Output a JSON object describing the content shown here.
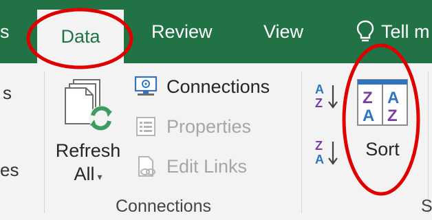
{
  "tabs": {
    "cut_left": "s",
    "data": "Data",
    "review": "Review",
    "view": "View",
    "tell": "Tell m"
  },
  "ribbon": {
    "left_cut_top": "s",
    "left_cut_bottom": "es",
    "refresh": {
      "line1": "Refresh",
      "line2": "All",
      "arrow": "▾"
    },
    "connections": "Connections",
    "properties": "Properties",
    "edit_links": "Edit Links",
    "group_connections_label": "Connections",
    "sort": "Sort",
    "group_right_cut": "S"
  },
  "icons": {
    "bulb": "lightbulb-icon",
    "refresh": "refresh-all-icon",
    "connections": "connections-icon",
    "properties": "properties-icon",
    "edit_links": "edit-links-icon",
    "sort_az": "sort-a-to-z-icon",
    "sort_za": "sort-z-to-a-icon",
    "sort": "sort-dialog-icon"
  },
  "colors": {
    "excel_green": "#217346",
    "ribbon_bg": "#f3f3f3",
    "annotation_red": "#e00000",
    "sort_blue": "#2e74c0",
    "sort_purple": "#7b3fa3"
  }
}
